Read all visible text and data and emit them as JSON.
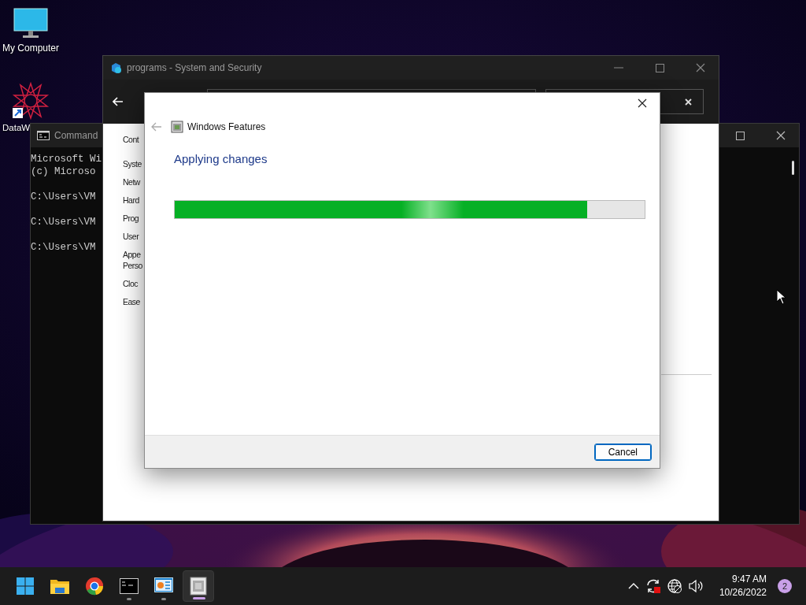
{
  "desktop_icons": [
    {
      "label": "My Computer",
      "kind": "monitor"
    },
    {
      "label": "DataW",
      "kind": "shortcut"
    }
  ],
  "command_window": {
    "title": "Command",
    "blocks": [
      [
        "Microsoft Wi",
        "(c) Microso"
      ],
      [
        "C:\\Users\\VM"
      ],
      [
        "C:\\Users\\VM"
      ],
      [
        "C:\\Users\\VM"
      ]
    ]
  },
  "control_panel": {
    "title": "programs - System and Security",
    "home_link": "Cont",
    "sidebar": [
      {
        "lines": [
          "Syste"
        ]
      },
      {
        "lines": [
          "Netw"
        ]
      },
      {
        "lines": [
          "Hard"
        ]
      },
      {
        "lines": [
          "Prog"
        ]
      },
      {
        "lines": [
          "User"
        ]
      },
      {
        "lines": [
          "Appe",
          "Perso"
        ]
      },
      {
        "lines": [
          "Cloc"
        ]
      },
      {
        "lines": [
          "Ease"
        ]
      }
    ]
  },
  "dialog": {
    "title": "Windows Features",
    "heading": "Applying changes",
    "progress": {
      "level": 0.878
    },
    "buttons": [
      "Cancel"
    ]
  },
  "taskbar": {
    "apps": [
      {
        "kind": "start",
        "running": false,
        "selected": false
      },
      {
        "kind": "folder",
        "running": false,
        "selected": false
      },
      {
        "kind": "browser",
        "running": false,
        "selected": false
      },
      {
        "kind": "terminal",
        "running": true,
        "selected": false
      },
      {
        "kind": "control-panel",
        "running": true,
        "selected": false
      },
      {
        "kind": "features",
        "running": true,
        "selected": true
      }
    ],
    "tray": {
      "time": "9:47 AM",
      "date": "10/26/2022",
      "notifications": "2"
    }
  }
}
